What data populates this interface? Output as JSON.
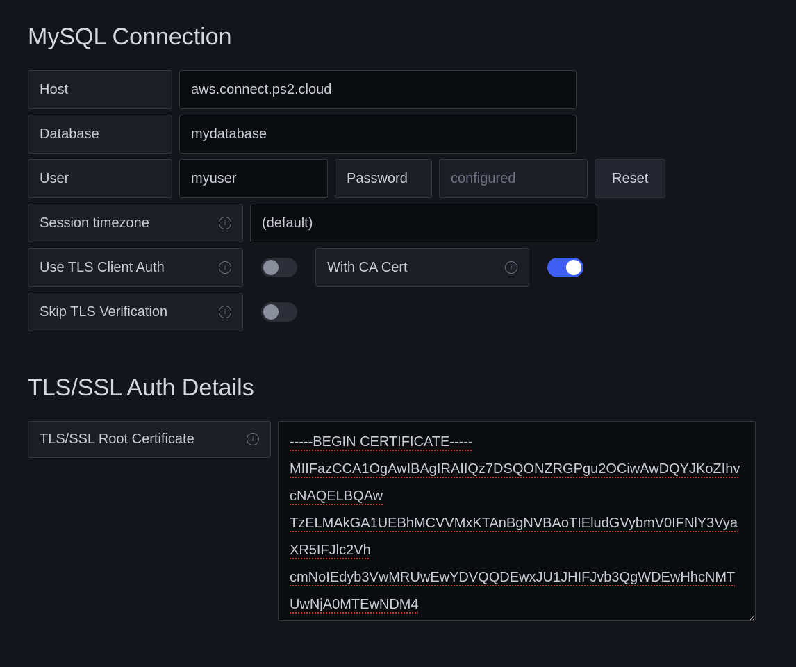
{
  "sections": {
    "mysql": {
      "title": "MySQL Connection",
      "host": {
        "label": "Host",
        "value": "aws.connect.ps2.cloud"
      },
      "database": {
        "label": "Database",
        "value": "mydatabase"
      },
      "user": {
        "label": "User",
        "value": "myuser"
      },
      "password": {
        "label": "Password",
        "placeholder": "configured",
        "value": ""
      },
      "reset_button": "Reset",
      "session_timezone": {
        "label": "Session timezone",
        "value": "(default)"
      },
      "use_tls_client_auth": {
        "label": "Use TLS Client Auth",
        "on": false
      },
      "with_ca_cert": {
        "label": "With CA Cert",
        "on": true
      },
      "skip_tls_verification": {
        "label": "Skip TLS Verification",
        "on": false
      }
    },
    "tls": {
      "title": "TLS/SSL Auth Details",
      "root_cert": {
        "label": "TLS/SSL Root Certificate",
        "value": "-----BEGIN CERTIFICATE-----\nMIIFazCCA1OgAwIBAgIRAIIQz7DSQONZRGPgu2OCiwAwDQYJKoZIhvcNAQELBQAw\nTzELMAkGA1UEBhMCVVMxKTAnBgNVBAoTIEludGVybmV0IFNlY3VyaXR5IFJlc2Vh\ncmNoIEdyb3VwMRUwEwYDVQQDEwxJU1JHIFJvb3QgWDEwHhcNMTUwNjA0MTEwNDM4"
      }
    }
  }
}
